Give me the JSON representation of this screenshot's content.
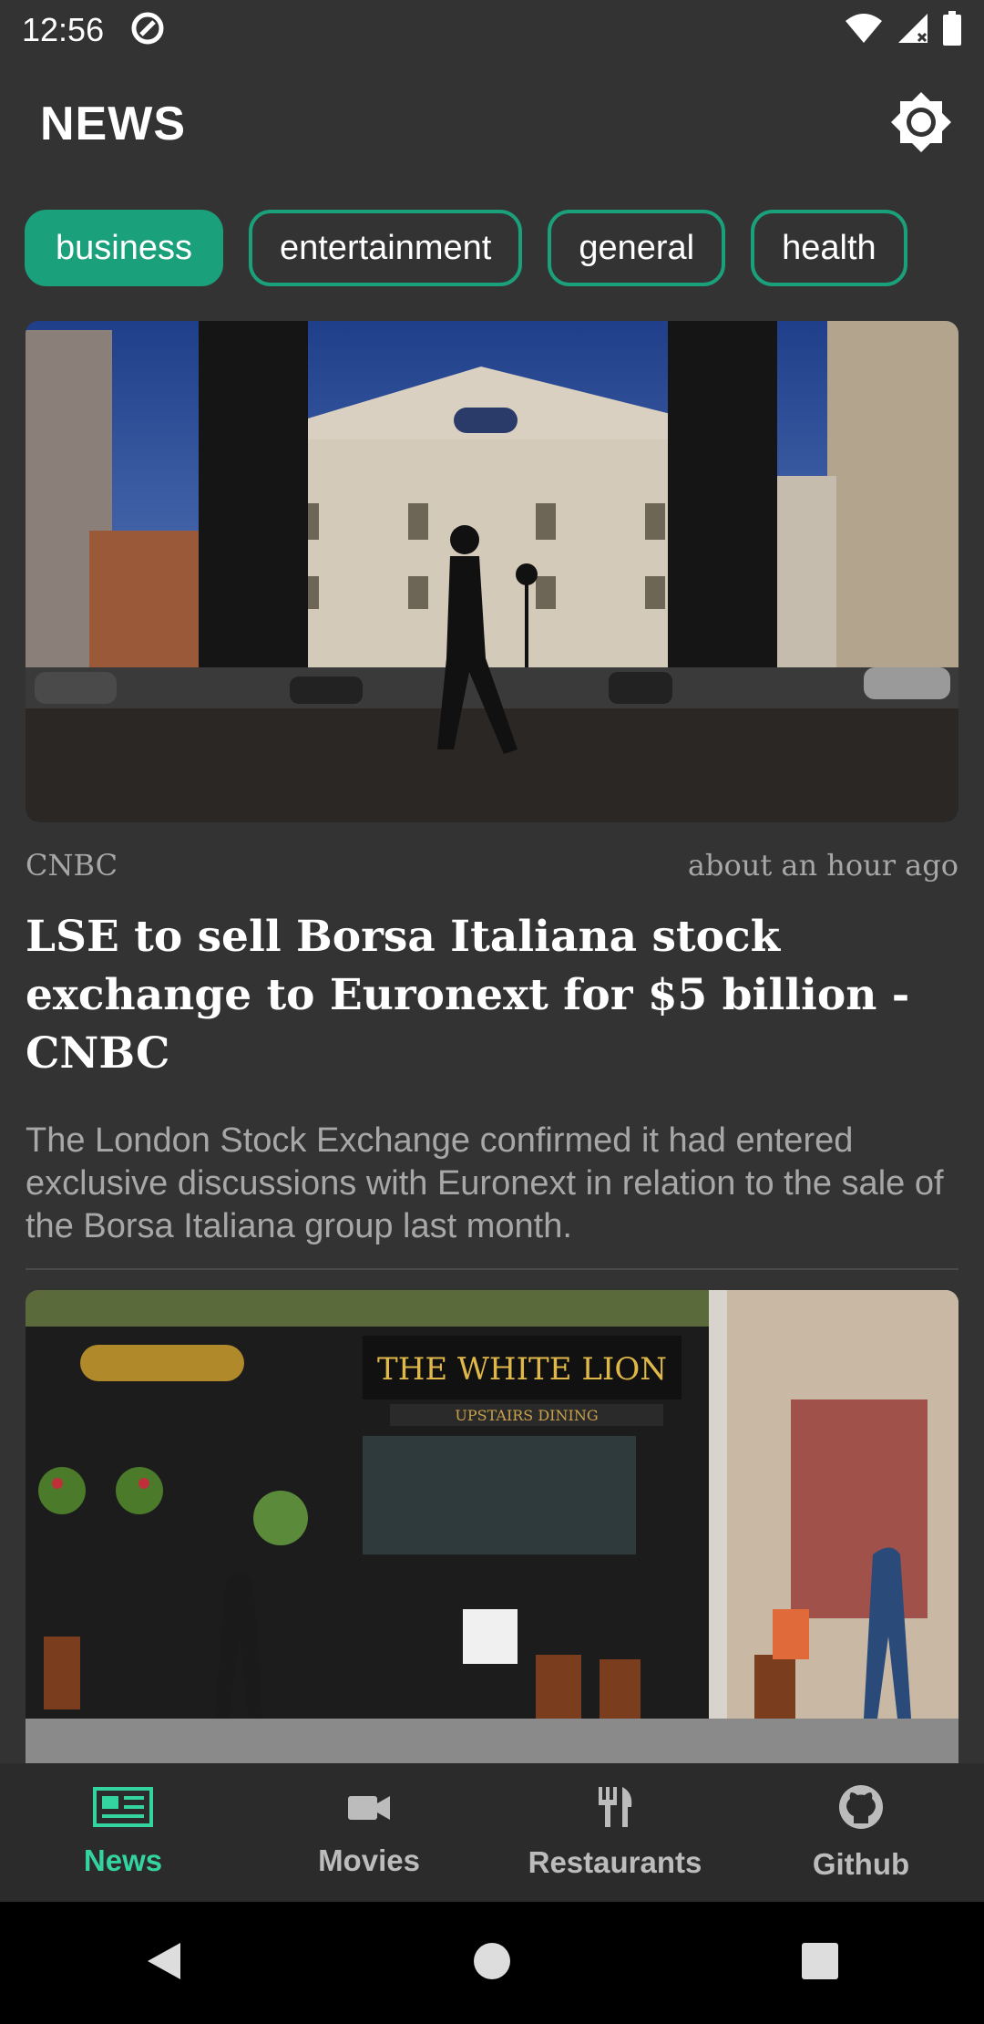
{
  "status_bar": {
    "time": "12:56"
  },
  "app_bar": {
    "title": "NEWS"
  },
  "categories": [
    {
      "label": "business",
      "active": true
    },
    {
      "label": "entertainment",
      "active": false
    },
    {
      "label": "general",
      "active": false
    },
    {
      "label": "health",
      "active": false
    }
  ],
  "articles": [
    {
      "source": "CNBC",
      "time_ago": "about an hour ago",
      "headline": "LSE to sell Borsa Italiana stock exchange to Euronext for $5 billion - CNBC",
      "description": "The  London Stock Exchange confirmed it had entered exclusive discussions with Euronext in relation to the sale of the Borsa Italiana group last month."
    },
    {
      "pub_sign": "THE WHITE LION",
      "pub_subsign": "UPSTAIRS DINING"
    }
  ],
  "bottom_nav": [
    {
      "label": "News",
      "icon": "newspaper-icon",
      "active": true
    },
    {
      "label": "Movies",
      "icon": "video-camera-icon",
      "active": false
    },
    {
      "label": "Restaurants",
      "icon": "fork-knife-icon",
      "active": false
    },
    {
      "label": "Github",
      "icon": "github-icon",
      "active": false
    }
  ],
  "colors": {
    "accent": "#1aa07a",
    "nav_active": "#34d4a0",
    "background": "#333333"
  }
}
